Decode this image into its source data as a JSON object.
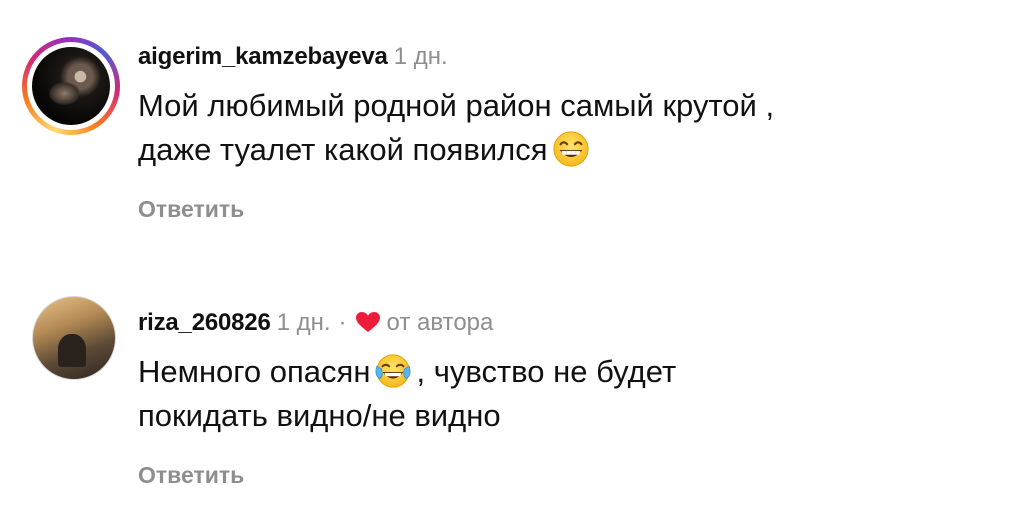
{
  "comments": [
    {
      "username": "aigerim_kamzebayeva",
      "time": "1 дн.",
      "lines": [
        "Мой любимый родной район самый крутой ,",
        "даже туалет какой появился"
      ],
      "emoji_icon": "grinning-face-with-smiling-eyes-icon",
      "reply_label": "Ответить",
      "has_story_ring": true
    },
    {
      "username": "riza_260826",
      "time": "1 дн.",
      "separator": "·",
      "author_like_label": "от автора",
      "author_like_icon": "heart-icon",
      "line_1_before": "Немного опасян",
      "line_1_after": ", чувство не будет",
      "line_2": "покидать видно/не видно",
      "emoji_icon": "face-with-tears-of-joy-icon",
      "reply_label": "Ответить",
      "has_story_ring": false
    }
  ],
  "colors": {
    "text": "#111111",
    "secondary": "#8e8e8e",
    "heart": "#ed1c3a"
  }
}
